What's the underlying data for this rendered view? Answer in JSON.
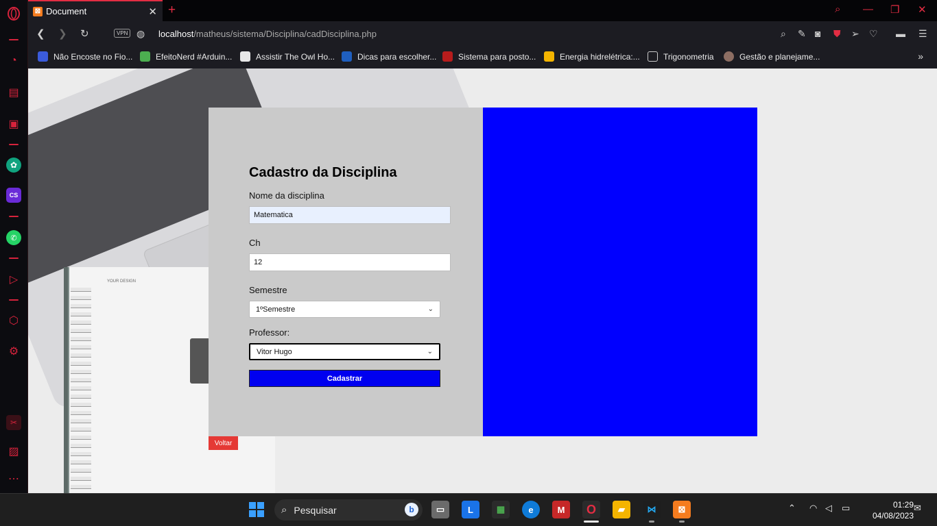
{
  "browser": {
    "tab_title": "Document",
    "tab_favicon": "xampp-icon",
    "url_host": "localhost",
    "url_path": "/matheus/sistema/Disciplina/cadDisciplina.php",
    "vpn_label": "VPN",
    "accent_color": "#e32d43"
  },
  "bookmarks": [
    {
      "label": "Não Encoste no Fio...",
      "icon": "puzzle-icon"
    },
    {
      "label": "EfeitoNerd #Arduin...",
      "icon": "pencil-icon"
    },
    {
      "label": "Assistir The Owl Ho...",
      "icon": "owl-icon"
    },
    {
      "label": "Dicas para escolher...",
      "icon": "bookmark-icon"
    },
    {
      "label": "Sistema para posto...",
      "icon": "flag-icon"
    },
    {
      "label": "Energia hidrelétrica:...",
      "icon": "energy-icon"
    },
    {
      "label": "Trigonometria",
      "icon": "folder-icon"
    },
    {
      "label": "Gestão e planejame...",
      "icon": "circle-icon"
    }
  ],
  "form": {
    "title": "Cadastro da Disciplina",
    "nome_label": "Nome da disciplina",
    "nome_value": "Matematica",
    "ch_label": "Ch",
    "ch_value": "12",
    "semestre_label": "Semestre",
    "semestre_value": "1ºSemestre",
    "professor_label": "Professor:",
    "professor_value": "Vitor Hugo",
    "submit_label": "Cadastrar",
    "back_label": "Voltar",
    "panel_color": "#0000ff"
  },
  "notebook": {
    "cover_text": "YOUR DESIGN"
  },
  "taskbar": {
    "search_placeholder": "Pesquisar",
    "time": "01:29",
    "date": "04/08/2023"
  }
}
